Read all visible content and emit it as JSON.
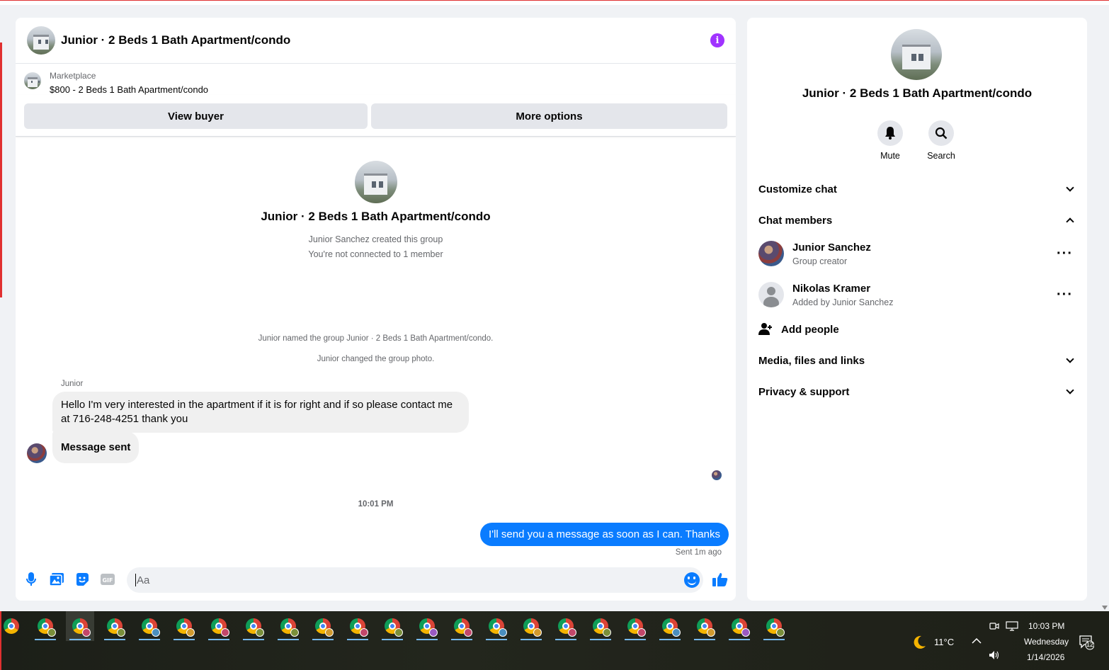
{
  "chat": {
    "title": "Junior · 2 Beds 1 Bath Apartment/condo",
    "marketplace_label": "Marketplace",
    "listing": "$800 - 2 Beds 1 Bath Apartment/condo",
    "view_buyer": "View buyer",
    "more_options": "More options",
    "intro_title": "Junior · 2 Beds 1 Bath Apartment/condo",
    "intro_created": "Junior Sanchez created this group",
    "intro_connection": "You're not connected to 1 member",
    "system_named": "Junior named the group Junior · 2 Beds 1 Bath Apartment/condo.",
    "system_photo": "Junior changed the group photo.",
    "sender_name": "Junior",
    "message_1": "Hello I'm very interested in the apartment if it is for right and if so please contact me at 716-248-4251 thank you",
    "message_2": "Message sent",
    "timestamp": "10:01 PM",
    "outgoing": "I'll send you a message as soon as I can. Thanks",
    "sent_status": "Sent 1m ago",
    "input_placeholder": "Aa"
  },
  "side": {
    "title": "Junior · 2 Beds 1 Bath Apartment/condo",
    "mute": "Mute",
    "search": "Search",
    "customize_chat": "Customize chat",
    "chat_members": "Chat members",
    "members": [
      {
        "name": "Junior Sanchez",
        "role": "Group creator"
      },
      {
        "name": "Nikolas Kramer",
        "role": "Added by Junior Sanchez"
      }
    ],
    "add_people": "Add people",
    "media": "Media, files and links",
    "privacy": "Privacy & support"
  },
  "taskbar": {
    "temperature": "11°C",
    "time": "10:03 PM",
    "day": "Wednesday",
    "date": "1/14/2026",
    "notifications": "12"
  },
  "colors": {
    "accent": "#0a7cff",
    "info": "#a033ff"
  }
}
